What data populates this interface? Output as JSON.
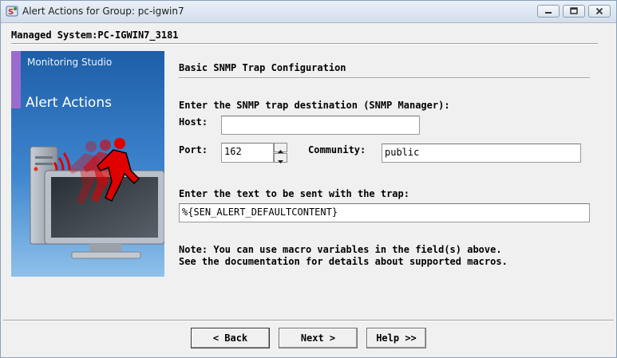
{
  "window": {
    "title": "Alert Actions for Group: pc-igwin7",
    "title_icon": "snmp-app-icon",
    "controls": [
      "minimize-icon",
      "maximize-icon",
      "close-icon"
    ]
  },
  "managed_system": "Managed System:PC-IGWIN7_3181",
  "banner": {
    "line1": "Monitoring Studio",
    "line2": "Alert Actions",
    "accent_color": "#9b6bcf",
    "figure_color": "#e00000",
    "illustration": "computer-with-running-person-illustration"
  },
  "form": {
    "heading": "Basic SNMP Trap Configuration",
    "destination_label": "Enter the SNMP trap destination (SNMP Manager):",
    "host_label": "Host:",
    "host_value": "",
    "port_label": "Port:",
    "port_value": "162",
    "community_label": "Community:",
    "community_value": "public",
    "text_label": "Enter the text to be sent with the trap:",
    "text_value": "%{SEN_ALERT_DEFAULTCONTENT}",
    "note_line1": "Note: You can use macro variables in the field(s) above.",
    "note_line2": "See the documentation for details about supported macros."
  },
  "buttons": {
    "back": "< Back",
    "next": "Next >",
    "help": "Help >>"
  }
}
